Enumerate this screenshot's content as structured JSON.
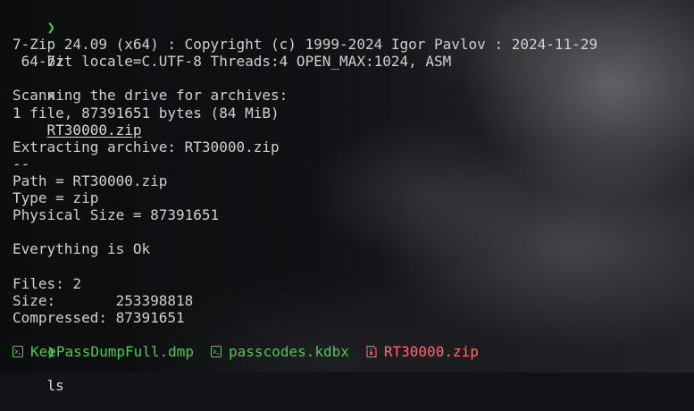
{
  "terminal": {
    "prompt_symbol": "❯",
    "command1": {
      "program": "7z",
      "sub": "x",
      "arg": "RT30000.zip"
    },
    "output": [
      "",
      "7-Zip 24.09 (x64) : Copyright (c) 1999-2024 Igor Pavlov : 2024-11-29",
      " 64-bit locale=C.UTF-8 Threads:4 OPEN_MAX:1024, ASM",
      "",
      "Scanning the drive for archives:",
      "1 file, 87391651 bytes (84 MiB)",
      "",
      "Extracting archive: RT30000.zip",
      "--",
      "Path = RT30000.zip",
      "Type = zip",
      "Physical Size = 87391651",
      "",
      "Everything is Ok",
      "",
      "Files: 2",
      "Size:       253398818",
      "Compressed: 87391651"
    ],
    "command2": {
      "program": "ls"
    },
    "listing": [
      {
        "icon": "terminal-file-icon",
        "name": "KeePassDumpFull.dmp",
        "color": "#4ec94e"
      },
      {
        "icon": "terminal-file-icon",
        "name": "passcodes.kdbx",
        "color": "#4ec94e"
      },
      {
        "icon": "archive-file-icon",
        "name": "RT30000.zip",
        "color": "#ff6b6b"
      }
    ]
  }
}
